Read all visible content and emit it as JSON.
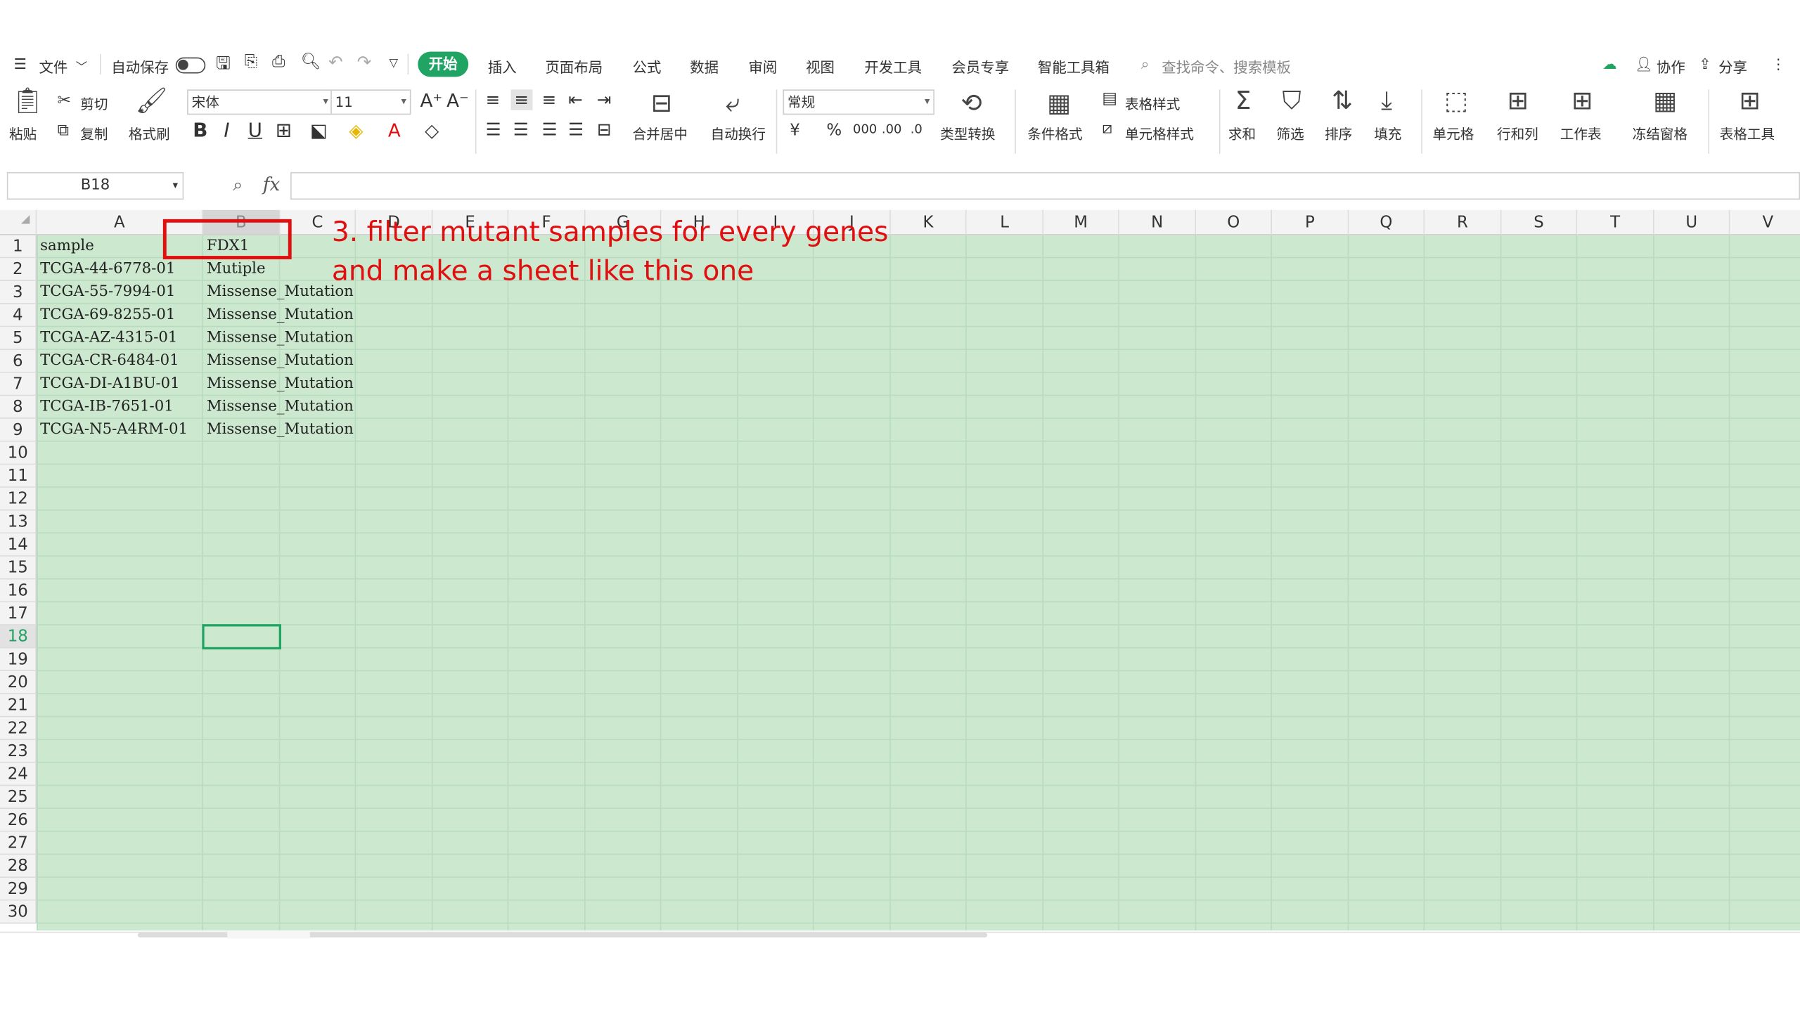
{
  "menu": {
    "file": "文件",
    "autosave": "自动保存",
    "tabs": [
      "开始",
      "插入",
      "页面布局",
      "公式",
      "数据",
      "审阅",
      "视图",
      "开发工具",
      "会员专享",
      "智能工具箱"
    ],
    "search_placeholder": "查找命令、搜索模板",
    "collab": "协作",
    "share": "分享"
  },
  "ribbon": {
    "paste": "粘贴",
    "cut": "剪切",
    "copy": "复制",
    "format_painter": "格式刷",
    "font_name": "宋体",
    "font_size": "11",
    "number_format": "常规",
    "merge_center": "合并居中",
    "wrap_text": "自动换行",
    "type_convert": "类型转换",
    "cond_format": "条件格式",
    "table_style": "表格样式",
    "cell_style": "单元格样式",
    "sum": "求和",
    "filter": "筛选",
    "sort": "排序",
    "fill": "填充",
    "cell": "单元格",
    "row_col": "行和列",
    "worksheet": "工作表",
    "freeze": "冻结窗格",
    "table_tools": "表格工具"
  },
  "formula_bar": {
    "name_box": "B18",
    "fx": "fx",
    "formula": ""
  },
  "sheet": {
    "columns": [
      "A",
      "B",
      "C",
      "D",
      "E",
      "F",
      "G",
      "H",
      "I",
      "J",
      "K",
      "L",
      "M",
      "N",
      "O",
      "P",
      "Q",
      "R",
      "S",
      "T",
      "U",
      "V"
    ],
    "rows": [
      "1",
      "2",
      "3",
      "4",
      "5",
      "6",
      "7",
      "8",
      "9",
      "10",
      "11",
      "12",
      "13",
      "14",
      "15",
      "16",
      "17",
      "18",
      "19",
      "20",
      "21",
      "22",
      "23",
      "24",
      "25",
      "26",
      "27",
      "28",
      "29",
      "30"
    ],
    "data": [
      [
        "sample",
        "FDX1"
      ],
      [
        "TCGA-44-6778-01",
        "Mutiple"
      ],
      [
        "TCGA-55-7994-01",
        "Missense_Mutation"
      ],
      [
        "TCGA-69-8255-01",
        "Missense_Mutation"
      ],
      [
        "TCGA-AZ-4315-01",
        "Missense_Mutation"
      ],
      [
        "TCGA-CR-6484-01",
        "Missense_Mutation"
      ],
      [
        "TCGA-DI-A1BU-01",
        "Missense_Mutation"
      ],
      [
        "TCGA-IB-7651-01",
        "Missense_Mutation"
      ],
      [
        "TCGA-N5-A4RM-01",
        "Missense_Mutation"
      ]
    ],
    "selected_cell": "B18"
  },
  "annotation": {
    "line1": "3. filter mutant samples for every genes",
    "line2": "and make a sheet like this one",
    "color": "#e01010"
  },
  "colors": {
    "accent": "#1fa463",
    "cell_bg": "#cce8cf"
  }
}
